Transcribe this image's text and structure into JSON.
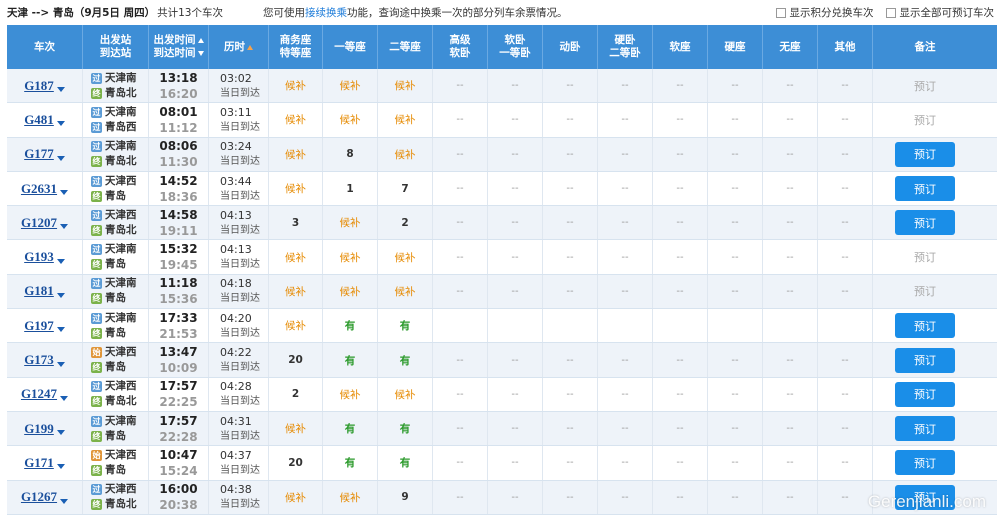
{
  "topbar": {
    "route": "天津 --> 青岛（9月5日 周四）",
    "count": "共计13个车次",
    "tip_prefix": "您可使用",
    "tip_link": "接续换乘",
    "tip_suffix": "功能，查询途中换乘一次的部分列车余票情况。",
    "opt_alternate": "显示积分兑换车次",
    "opt_all_bookable": "显示全部可预订车次"
  },
  "header": {
    "train": "车次",
    "stations": [
      "出发站",
      "到达站"
    ],
    "times": [
      "出发时间",
      "到达时间"
    ],
    "duration": "历时",
    "business": [
      "商务座",
      "特等座"
    ],
    "first": "一等座",
    "second": "二等座",
    "soft_premium": [
      "高级",
      "软卧"
    ],
    "soft_first": [
      "软卧",
      "一等卧"
    ],
    "moving": "动卧",
    "hard_second": [
      "硬卧",
      "二等卧"
    ],
    "soft_seat": "软座",
    "hard_seat": "硬座",
    "no_seat": "无座",
    "other": "其他",
    "note": "备注"
  },
  "rows": [
    {
      "train": "G187",
      "from": "天津南",
      "from_type": "pass",
      "to": "青岛北",
      "to_type": "end",
      "dep": "13:18",
      "arr": "16:20",
      "dur": "03:02",
      "day": "当日到达",
      "biz": "候补",
      "first": "候补",
      "second": "候补",
      "soft_premium": "--",
      "soft_first": "--",
      "moving": "--",
      "hard_second": "--",
      "soft_seat": "--",
      "hard_seat": "--",
      "no_seat": "--",
      "other": "--",
      "book": "预订",
      "book_enabled": false
    },
    {
      "train": "G481",
      "from": "天津南",
      "from_type": "pass",
      "to": "青岛西",
      "to_type": "pass",
      "dep": "08:01",
      "arr": "11:12",
      "dur": "03:11",
      "day": "当日到达",
      "biz": "候补",
      "first": "候补",
      "second": "候补",
      "soft_premium": "--",
      "soft_first": "--",
      "moving": "--",
      "hard_second": "--",
      "soft_seat": "--",
      "hard_seat": "--",
      "no_seat": "--",
      "other": "--",
      "book": "预订",
      "book_enabled": false
    },
    {
      "train": "G177",
      "from": "天津南",
      "from_type": "pass",
      "to": "青岛北",
      "to_type": "end",
      "dep": "08:06",
      "arr": "11:30",
      "dur": "03:24",
      "day": "当日到达",
      "biz": "候补",
      "first": "8",
      "second": "候补",
      "soft_premium": "--",
      "soft_first": "--",
      "moving": "--",
      "hard_second": "--",
      "soft_seat": "--",
      "hard_seat": "--",
      "no_seat": "--",
      "other": "--",
      "book": "预订",
      "book_enabled": true
    },
    {
      "train": "G2631",
      "from": "天津西",
      "from_type": "pass",
      "to": "青岛",
      "to_type": "end",
      "dep": "14:52",
      "arr": "18:36",
      "dur": "03:44",
      "day": "当日到达",
      "biz": "候补",
      "first": "1",
      "second": "7",
      "soft_premium": "--",
      "soft_first": "--",
      "moving": "--",
      "hard_second": "--",
      "soft_seat": "--",
      "hard_seat": "--",
      "no_seat": "--",
      "other": "--",
      "book": "预订",
      "book_enabled": true
    },
    {
      "train": "G1207",
      "from": "天津西",
      "from_type": "pass",
      "to": "青岛北",
      "to_type": "end",
      "dep": "14:58",
      "arr": "19:11",
      "dur": "04:13",
      "day": "当日到达",
      "biz": "3",
      "first": "候补",
      "second": "2",
      "soft_premium": "--",
      "soft_first": "--",
      "moving": "--",
      "hard_second": "--",
      "soft_seat": "--",
      "hard_seat": "--",
      "no_seat": "--",
      "other": "--",
      "book": "预订",
      "book_enabled": true
    },
    {
      "train": "G193",
      "from": "天津南",
      "from_type": "pass",
      "to": "青岛",
      "to_type": "end",
      "dep": "15:32",
      "arr": "19:45",
      "dur": "04:13",
      "day": "当日到达",
      "biz": "候补",
      "first": "候补",
      "second": "候补",
      "soft_premium": "--",
      "soft_first": "--",
      "moving": "--",
      "hard_second": "--",
      "soft_seat": "--",
      "hard_seat": "--",
      "no_seat": "--",
      "other": "--",
      "book": "预订",
      "book_enabled": false
    },
    {
      "train": "G181",
      "from": "天津南",
      "from_type": "pass",
      "to": "青岛",
      "to_type": "end",
      "dep": "11:18",
      "arr": "15:36",
      "dur": "04:18",
      "day": "当日到达",
      "biz": "候补",
      "first": "候补",
      "second": "候补",
      "soft_premium": "--",
      "soft_first": "--",
      "moving": "--",
      "hard_second": "--",
      "soft_seat": "--",
      "hard_seat": "--",
      "no_seat": "--",
      "other": "--",
      "book": "预订",
      "book_enabled": false
    },
    {
      "train": "G197",
      "from": "天津南",
      "from_type": "pass",
      "to": "青岛",
      "to_type": "end",
      "dep": "17:33",
      "arr": "21:53",
      "dur": "04:20",
      "day": "当日到达",
      "biz": "候补",
      "first": "有",
      "second": "有",
      "soft_premium": "",
      "soft_first": "",
      "moving": "",
      "hard_second": "",
      "soft_seat": "",
      "hard_seat": "",
      "no_seat": "",
      "other": "",
      "book": "预订",
      "book_enabled": true
    },
    {
      "train": "G173",
      "from": "天津西",
      "from_type": "start",
      "to": "青岛",
      "to_type": "end",
      "dep": "13:47",
      "arr": "10:09",
      "dur": "04:22",
      "day": "当日到达",
      "biz": "20",
      "first": "有",
      "second": "有",
      "soft_premium": "--",
      "soft_first": "--",
      "moving": "--",
      "hard_second": "--",
      "soft_seat": "--",
      "hard_seat": "--",
      "no_seat": "--",
      "other": "--",
      "book": "预订",
      "book_enabled": true
    },
    {
      "train": "G1247",
      "from": "天津西",
      "from_type": "pass",
      "to": "青岛北",
      "to_type": "end",
      "dep": "17:57",
      "arr": "22:25",
      "dur": "04:28",
      "day": "当日到达",
      "biz": "2",
      "first": "候补",
      "second": "候补",
      "soft_premium": "--",
      "soft_first": "--",
      "moving": "--",
      "hard_second": "--",
      "soft_seat": "--",
      "hard_seat": "--",
      "no_seat": "--",
      "other": "--",
      "book": "预订",
      "book_enabled": true
    },
    {
      "train": "G199",
      "from": "天津南",
      "from_type": "pass",
      "to": "青岛",
      "to_type": "end",
      "dep": "17:57",
      "arr": "22:28",
      "dur": "04:31",
      "day": "当日到达",
      "biz": "候补",
      "first": "有",
      "second": "有",
      "soft_premium": "--",
      "soft_first": "--",
      "moving": "--",
      "hard_second": "--",
      "soft_seat": "--",
      "hard_seat": "--",
      "no_seat": "--",
      "other": "--",
      "book": "预订",
      "book_enabled": true
    },
    {
      "train": "G171",
      "from": "天津西",
      "from_type": "start",
      "to": "青岛",
      "to_type": "end",
      "dep": "10:47",
      "arr": "15:24",
      "dur": "04:37",
      "day": "当日到达",
      "biz": "20",
      "first": "有",
      "second": "有",
      "soft_premium": "--",
      "soft_first": "--",
      "moving": "--",
      "hard_second": "--",
      "soft_seat": "--",
      "hard_seat": "--",
      "no_seat": "--",
      "other": "--",
      "book": "预订",
      "book_enabled": true
    },
    {
      "train": "G1267",
      "from": "天津西",
      "from_type": "pass",
      "to": "青岛北",
      "to_type": "end",
      "dep": "16:00",
      "arr": "20:38",
      "dur": "04:38",
      "day": "当日到达",
      "biz": "候补",
      "first": "候补",
      "second": "9",
      "soft_premium": "--",
      "soft_first": "--",
      "moving": "--",
      "hard_second": "--",
      "soft_seat": "--",
      "hard_seat": "--",
      "no_seat": "--",
      "other": "--",
      "book": "预订",
      "book_enabled": true
    }
  ],
  "badge_glyphs": {
    "pass": "过",
    "start": "始",
    "end": "终"
  },
  "watermark": "Gerenjianli.com",
  "colors": {
    "header_bg": "#3d8ed6",
    "book_button": "#1a8ee8",
    "waitlist": "#e68a00",
    "available": "#2b9a2b",
    "train_code": "#1a4f9c"
  }
}
